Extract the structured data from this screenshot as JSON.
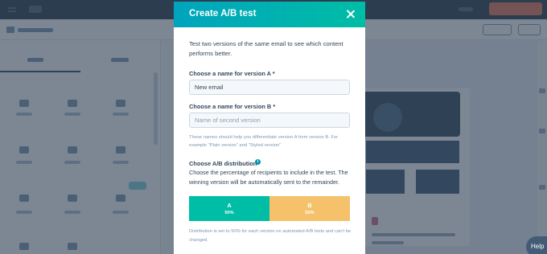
{
  "modal": {
    "title": "Create A/B test",
    "intro": "Test two versions of the same email to see which content performs better.",
    "version_a": {
      "label": "Choose a name for version A *",
      "value": "New email",
      "placeholder": ""
    },
    "version_b": {
      "label": "Choose a name for version B *",
      "value": "",
      "placeholder": "Name of second version"
    },
    "hint": "These names should help you differentiate version A from version B. For example \"Plain version\" and \"Styled version\"",
    "distribution": {
      "title": "Choose A/B distribution",
      "description": "Choose the percentage of recipients to include in the test. The winning version will be automatically sent to the remainder.",
      "split": [
        {
          "letter": "A",
          "percent_label": "50%",
          "percent": 50,
          "color": "#00bda5"
        },
        {
          "letter": "B",
          "percent_label": "50%",
          "percent": 50,
          "color": "#f5c26b"
        }
      ],
      "footnote": "Distribution is set to 50% for each version on automated A/B tests and can't be changed."
    }
  },
  "help": {
    "label": "Help"
  },
  "colors": {
    "header_gradient_start": "#00a4bd",
    "header_gradient_end": "#00bda5",
    "text": "#33475b",
    "muted": "#7c98b6",
    "overlay": "#2d3e50"
  }
}
